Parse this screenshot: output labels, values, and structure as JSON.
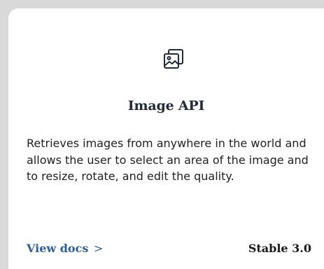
{
  "card": {
    "icon": "image-gallery-icon",
    "title": "Image API",
    "description": "Retrieves images from anywhere in the world and allows the user to select an area of the image and to resize, rotate, and edit the quality.",
    "link_label": "View docs",
    "link_chevron": ">",
    "status_label": "Stable 3.0"
  },
  "colors": {
    "background": "#d9d9d9",
    "card": "#ffffff",
    "title": "#222b3a",
    "link": "#2a5f9e",
    "text": "#1f1f1f"
  }
}
